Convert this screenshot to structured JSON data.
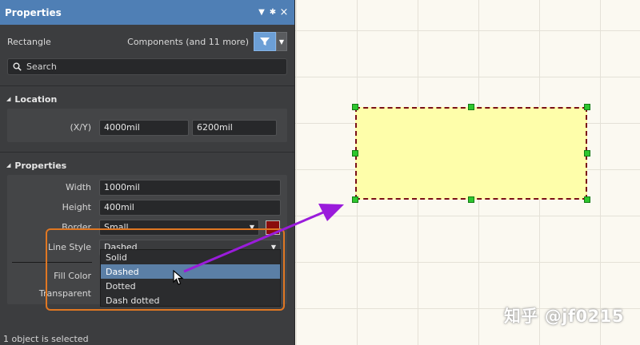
{
  "panel": {
    "title": "Properties",
    "object_type": "Rectangle",
    "filter_label": "Components (and 11 more)",
    "search_placeholder": "Search",
    "sections": {
      "location": "Location",
      "properties": "Properties"
    },
    "location": {
      "label": "(X/Y)",
      "x": "4000mil",
      "y": "6200mil"
    },
    "properties": {
      "width_label": "Width",
      "width_value": "1000mil",
      "height_label": "Height",
      "height_value": "400mil",
      "border_label": "Border",
      "border_value": "Small",
      "border_color": "#8a0d0d",
      "line_style_label": "Line Style",
      "line_style_value": "Dashed",
      "fill_color_label": "Fill Color",
      "transparent_label": "Transparent"
    },
    "line_style_options": [
      "Solid",
      "Dashed",
      "Dotted",
      "Dash dotted"
    ],
    "status": "1 object is selected"
  },
  "canvas": {
    "shape_fill": "#fefeaa",
    "shape_border": "#7a0f16",
    "handle_color": "#2ec62e"
  },
  "watermark": "知乎 @jf0215",
  "colors": {
    "accent": "#4f7fb5",
    "highlight_box": "#e07722",
    "annotation_arrow": "#9a1cdb"
  }
}
